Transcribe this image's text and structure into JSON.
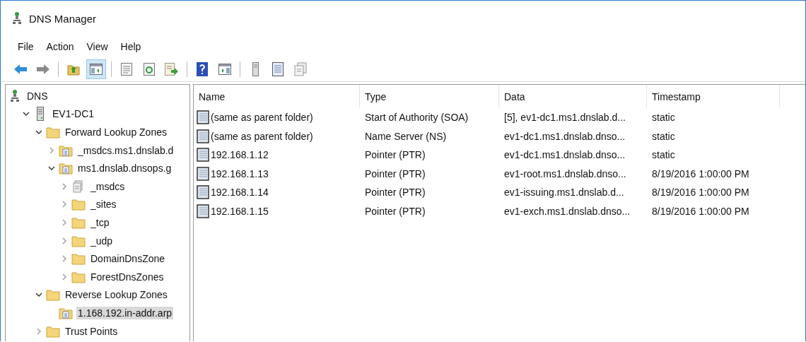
{
  "window": {
    "title": "DNS Manager"
  },
  "menu": [
    "File",
    "Action",
    "View",
    "Help"
  ],
  "toolbar": [
    {
      "kind": "back",
      "pressed": false
    },
    {
      "kind": "forward",
      "pressed": false
    },
    {
      "kind": "sep"
    },
    {
      "kind": "up",
      "pressed": false
    },
    {
      "kind": "tree",
      "pressed": true
    },
    {
      "kind": "sep"
    },
    {
      "kind": "properties",
      "pressed": false
    },
    {
      "kind": "refresh",
      "pressed": false
    },
    {
      "kind": "export",
      "pressed": false
    },
    {
      "kind": "sep"
    },
    {
      "kind": "help",
      "pressed": false
    },
    {
      "kind": "action-pane",
      "pressed": false
    },
    {
      "kind": "sep"
    },
    {
      "kind": "server",
      "pressed": false
    },
    {
      "kind": "list",
      "pressed": false
    },
    {
      "kind": "copy",
      "pressed": false
    }
  ],
  "tree": [
    {
      "label": "DNS",
      "kind": "dns",
      "selected": false,
      "children": [
        {
          "label": "EV1-DC1",
          "kind": "server",
          "expanded": true,
          "selected": false,
          "children": [
            {
              "label": "Forward Lookup Zones",
              "kind": "folder",
              "expanded": true,
              "selected": false,
              "children": [
                {
                  "label": "_msdcs.ms1.dnslab.d",
                  "kind": "zone",
                  "expanded": false,
                  "selected": false
                },
                {
                  "label": "ms1.dnslab.dnsops.g",
                  "kind": "zone",
                  "expanded": true,
                  "selected": false,
                  "children": [
                    {
                      "label": "_msdcs",
                      "kind": "delegation",
                      "expanded": false,
                      "selected": false
                    },
                    {
                      "label": "_sites",
                      "kind": "folder",
                      "expanded": false,
                      "selected": false
                    },
                    {
                      "label": "_tcp",
                      "kind": "folder",
                      "expanded": false,
                      "selected": false
                    },
                    {
                      "label": "_udp",
                      "kind": "folder",
                      "expanded": false,
                      "selected": false
                    },
                    {
                      "label": "DomainDnsZone",
                      "kind": "folder",
                      "expanded": false,
                      "selected": false
                    },
                    {
                      "label": "ForestDnsZones",
                      "kind": "folder",
                      "expanded": false,
                      "selected": false
                    }
                  ]
                }
              ]
            },
            {
              "label": "Reverse Lookup Zones",
              "kind": "folder",
              "expanded": true,
              "selected": false,
              "children": [
                {
                  "label": "1.168.192.in-addr.arp",
                  "kind": "zone",
                  "selected": true
                }
              ]
            },
            {
              "label": "Trust Points",
              "kind": "folder",
              "expanded": false,
              "selected": false
            }
          ]
        }
      ]
    }
  ],
  "table": {
    "columns": [
      "Name",
      "Type",
      "Data",
      "Timestamp"
    ],
    "rows": [
      [
        "(same as parent folder)",
        "Start of Authority (SOA)",
        "[5], ev1-dc1.ms1.dnslab.d...",
        "static"
      ],
      [
        "(same as parent folder)",
        "Name Server (NS)",
        "ev1-dc1.ms1.dnslab.dnso...",
        "static"
      ],
      [
        "192.168.1.12",
        "Pointer (PTR)",
        "ev1-dc1.ms1.dnslab.dnso...",
        "static"
      ],
      [
        "192.168.1.13",
        "Pointer (PTR)",
        "ev1-root.ms1.dnslab.dnso...",
        "8/19/2016 1:00:00 PM"
      ],
      [
        "192.168.1.14",
        "Pointer (PTR)",
        "ev1-issuing.ms1.dnslab.d...",
        "8/19/2016 1:00:00 PM"
      ],
      [
        "192.168.1.15",
        "Pointer (PTR)",
        "ev1-exch.ms1.dnslab.dnso...",
        "8/19/2016 1:00:00 PM"
      ]
    ]
  }
}
